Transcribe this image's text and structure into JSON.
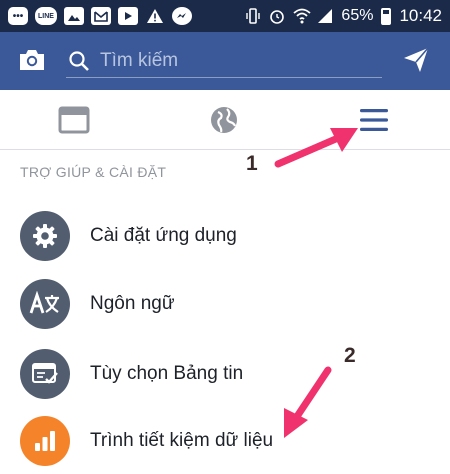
{
  "status_bar": {
    "battery": "65%",
    "time": "10:42",
    "icons": [
      "dots-icon",
      "line-app-icon",
      "image-icon",
      "mail-icon",
      "play-icon",
      "warning-icon",
      "messenger-icon",
      "vibrate-icon",
      "alarm-icon",
      "wifi-icon",
      "signal-icon",
      "battery-icon"
    ]
  },
  "header": {
    "search_placeholder": "Tìm kiếm",
    "brand_color": "#3b5998"
  },
  "tabs": [
    "feed-icon",
    "globe-icon",
    "menu-icon"
  ],
  "section": {
    "title": "TRỢ GIÚP & CÀI ĐẶT",
    "items": [
      {
        "label": "Cài đặt ứng dụng",
        "icon": "gear-icon"
      },
      {
        "label": "Ngôn ngữ",
        "icon": "translate-icon"
      },
      {
        "label": "Tùy chọn Bảng tin",
        "icon": "feed-preferences-icon"
      },
      {
        "label": "Trình tiết kiệm dữ liệu",
        "icon": "data-saver-icon"
      }
    ]
  },
  "annotations": {
    "marker_1": "1",
    "marker_2": "2",
    "arrow_color": "#f0326e"
  }
}
